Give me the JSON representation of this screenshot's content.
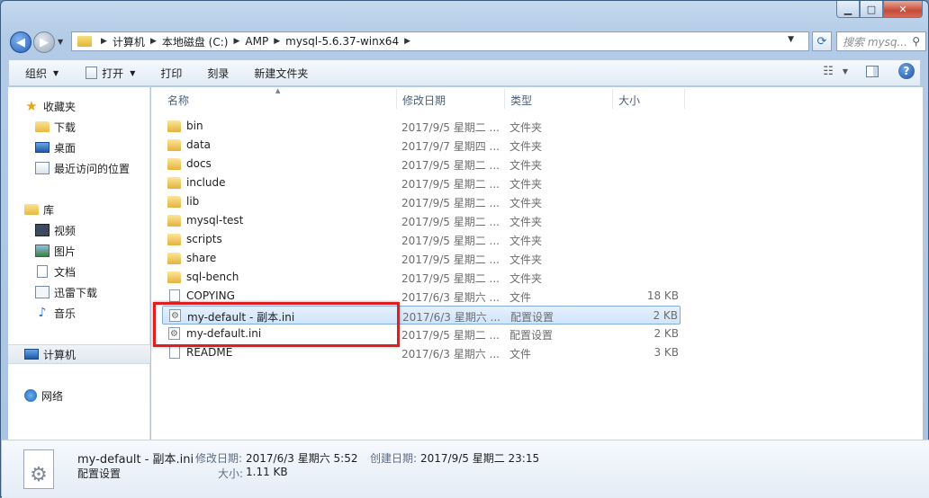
{
  "window": {
    "caption": {
      "minimize": "▁",
      "maximize": "□",
      "close": "✕"
    }
  },
  "address": {
    "crumbs": [
      "计算机",
      "本地磁盘 (C:)",
      "AMP",
      "mysql-5.6.37-winx64"
    ],
    "search_placeholder": "搜索 mysq..."
  },
  "toolbar": {
    "organize": "组织",
    "open": "打开",
    "print": "打印",
    "burn": "刻录",
    "new_folder": "新建文件夹"
  },
  "sidebar": {
    "favorites": "收藏夹",
    "fav_items": [
      "下载",
      "桌面",
      "最近访问的位置"
    ],
    "libraries": "库",
    "lib_items": [
      "视频",
      "图片",
      "文档",
      "迅雷下载",
      "音乐"
    ],
    "computer": "计算机",
    "network": "网络"
  },
  "columns": {
    "name": "名称",
    "date": "修改日期",
    "type": "类型",
    "size": "大小"
  },
  "files": [
    {
      "name": "bin",
      "date": "2017/9/5 星期二 ...",
      "type": "文件夹",
      "size": "",
      "kind": "folder"
    },
    {
      "name": "data",
      "date": "2017/9/7 星期四 ...",
      "type": "文件夹",
      "size": "",
      "kind": "folder"
    },
    {
      "name": "docs",
      "date": "2017/9/5 星期二 ...",
      "type": "文件夹",
      "size": "",
      "kind": "folder"
    },
    {
      "name": "include",
      "date": "2017/9/5 星期二 ...",
      "type": "文件夹",
      "size": "",
      "kind": "folder"
    },
    {
      "name": "lib",
      "date": "2017/9/5 星期二 ...",
      "type": "文件夹",
      "size": "",
      "kind": "folder"
    },
    {
      "name": "mysql-test",
      "date": "2017/9/5 星期二 ...",
      "type": "文件夹",
      "size": "",
      "kind": "folder"
    },
    {
      "name": "scripts",
      "date": "2017/9/5 星期二 ...",
      "type": "文件夹",
      "size": "",
      "kind": "folder"
    },
    {
      "name": "share",
      "date": "2017/9/5 星期二 ...",
      "type": "文件夹",
      "size": "",
      "kind": "folder"
    },
    {
      "name": "sql-bench",
      "date": "2017/9/5 星期二 ...",
      "type": "文件夹",
      "size": "",
      "kind": "folder"
    },
    {
      "name": "COPYING",
      "date": "2017/6/3 星期六 ...",
      "type": "文件",
      "size": "18 KB",
      "kind": "file"
    },
    {
      "name": "my-default - 副本.ini",
      "date": "2017/6/3 星期六 ...",
      "type": "配置设置",
      "size": "2 KB",
      "kind": "ini",
      "selected": true
    },
    {
      "name": "my-default.ini",
      "date": "2017/9/5 星期二 ...",
      "type": "配置设置",
      "size": "2 KB",
      "kind": "ini"
    },
    {
      "name": "README",
      "date": "2017/6/3 星期六 ...",
      "type": "文件",
      "size": "3 KB",
      "kind": "file"
    }
  ],
  "details": {
    "filename": "my-default - 副本.ini",
    "filetype": "配置设置",
    "modified_label": "修改日期:",
    "modified_value": "2017/6/3 星期六 5:52",
    "created_label": "创建日期:",
    "created_value": "2017/9/5 星期二 23:15",
    "size_label": "大小:",
    "size_value": "1.11 KB"
  }
}
